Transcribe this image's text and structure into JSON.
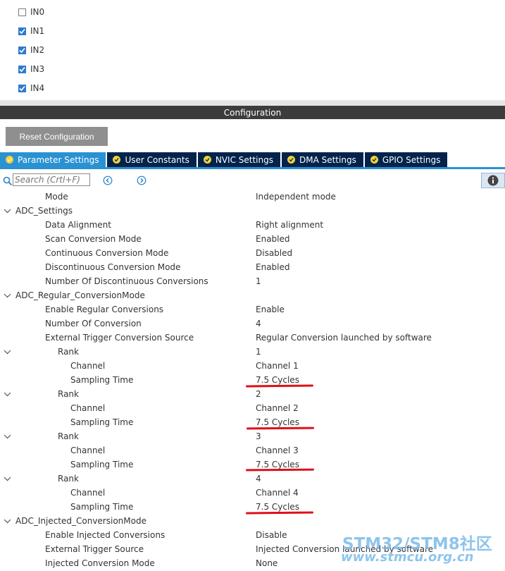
{
  "channels": [
    {
      "label": "IN0",
      "checked": false
    },
    {
      "label": "IN1",
      "checked": true
    },
    {
      "label": "IN2",
      "checked": true
    },
    {
      "label": "IN3",
      "checked": true
    },
    {
      "label": "IN4",
      "checked": true
    }
  ],
  "config_title": "Configuration",
  "reset_label": "Reset Configuration",
  "tabs": [
    {
      "label": "Parameter Settings",
      "active": true
    },
    {
      "label": "User Constants",
      "active": false
    },
    {
      "label": "NVIC Settings",
      "active": false
    },
    {
      "label": "DMA Settings",
      "active": false
    },
    {
      "label": "GPIO Settings",
      "active": false
    }
  ],
  "search": {
    "placeholder": "Search (Crtl+F)"
  },
  "tree": {
    "mode": {
      "label": "Mode",
      "value": "Independent mode"
    },
    "adc_settings": {
      "label": "ADC_Settings",
      "data_alignment": {
        "label": "Data Alignment",
        "value": "Right alignment"
      },
      "scan_mode": {
        "label": "Scan Conversion Mode",
        "value": "Enabled"
      },
      "continuous_mode": {
        "label": "Continuous Conversion Mode",
        "value": "Disabled"
      },
      "discontinuous_mode": {
        "label": "Discontinuous Conversion Mode",
        "value": "Enabled"
      },
      "num_discontinuous": {
        "label": "Number Of Discontinuous Conversions",
        "value": "1"
      }
    },
    "regular": {
      "label": "ADC_Regular_ConversionMode",
      "enable": {
        "label": "Enable Regular Conversions",
        "value": "Enable"
      },
      "num_conversion": {
        "label": "Number Of Conversion",
        "value": "4"
      },
      "trigger_source": {
        "label": "External Trigger Conversion Source",
        "value": "Regular Conversion launched by software"
      },
      "ranks": [
        {
          "label": "Rank",
          "value": "1",
          "channel_label": "Channel",
          "channel": "Channel 1",
          "sampling_label": "Sampling Time",
          "sampling": "7.5 Cycles"
        },
        {
          "label": "Rank",
          "value": "2",
          "channel_label": "Channel",
          "channel": "Channel 2",
          "sampling_label": "Sampling Time",
          "sampling": "7.5 Cycles"
        },
        {
          "label": "Rank",
          "value": "3",
          "channel_label": "Channel",
          "channel": "Channel 3",
          "sampling_label": "Sampling Time",
          "sampling": "7.5 Cycles"
        },
        {
          "label": "Rank",
          "value": "4",
          "channel_label": "Channel",
          "channel": "Channel 4",
          "sampling_label": "Sampling Time",
          "sampling": "7.5 Cycles"
        }
      ]
    },
    "injected": {
      "label": "ADC_Injected_ConversionMode",
      "enable": {
        "label": "Enable Injected Conversions",
        "value": "Disable"
      },
      "trigger_source": {
        "label": "External Trigger Source",
        "value": "Injected Conversion launched by software"
      },
      "mode": {
        "label": "Injected Conversion Mode",
        "value": "None"
      }
    }
  },
  "watermark": {
    "line1": "STM32/STM8社区",
    "line2": "www.stmcu.org.cn"
  },
  "colors": {
    "accent": "#2a91d2",
    "tab_dark": "#03234b",
    "highlight": "#e0101a",
    "check": "#2e7bcf"
  }
}
